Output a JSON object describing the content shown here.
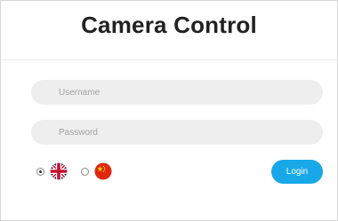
{
  "header": {
    "title": "Camera Control"
  },
  "form": {
    "username": {
      "placeholder": "Username",
      "value": ""
    },
    "password": {
      "placeholder": "Password",
      "value": ""
    },
    "languages": [
      {
        "name": "English",
        "icon": "uk-flag-icon",
        "selected": true
      },
      {
        "name": "Chinese",
        "icon": "china-flag-icon",
        "selected": false
      }
    ],
    "login_label": "Login"
  },
  "colors": {
    "accent": "#18a8e8",
    "field_bg": "#eeeeee",
    "title": "#222222"
  }
}
